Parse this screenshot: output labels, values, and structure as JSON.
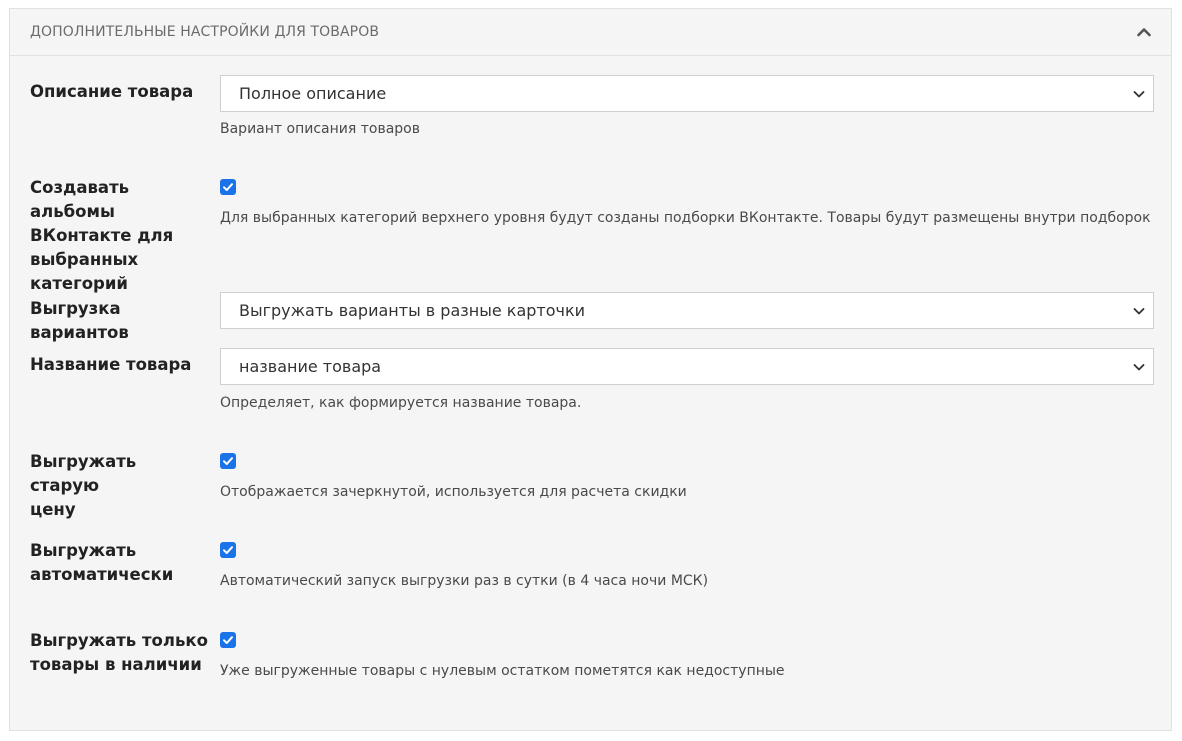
{
  "panel": {
    "title": "ДОПОЛНИТЕЛЬНЫЕ НАСТРОЙКИ ДЛЯ ТОВАРОВ",
    "collapse_icon": "chevron-up-icon"
  },
  "fields": {
    "description": {
      "label": "Описание товара",
      "value": "Полное описание",
      "help": "Вариант описания товаров"
    },
    "albums": {
      "label_lines": [
        "Создавать альбомы",
        "ВКонтакте для",
        "выбранных",
        "категорий"
      ],
      "checked": true,
      "help": "Для выбранных категорий верхнего уровня будут созданы подборки ВКонтакте. Товары будут размещены внутри подборок"
    },
    "variants": {
      "label": "Выгрузка вариантов",
      "value": "Выгружать варианты в разные карточки"
    },
    "product_name": {
      "label": "Название товара",
      "value": "название товара",
      "help": "Определяет, как формируется название товара."
    },
    "old_price": {
      "label_lines": [
        "Выгружать старую",
        "цену"
      ],
      "checked": true,
      "help": "Отображается зачеркнутой, используется для расчета скидки"
    },
    "auto_export": {
      "label_lines": [
        "Выгружать",
        "автоматически"
      ],
      "checked": true,
      "help": "Автоматический запуск выгрузки раз в сутки (в 4 часа ночи МСК)"
    },
    "in_stock_only": {
      "label_lines": [
        "Выгружать только",
        "товары в наличии"
      ],
      "checked": true,
      "help": "Уже выгруженные товары с нулевым остатком пометятся как недоступные"
    }
  },
  "colors": {
    "checkbox": "#1a73e8",
    "panel_bg": "#f5f5f5",
    "border": "#e1e1e1"
  }
}
